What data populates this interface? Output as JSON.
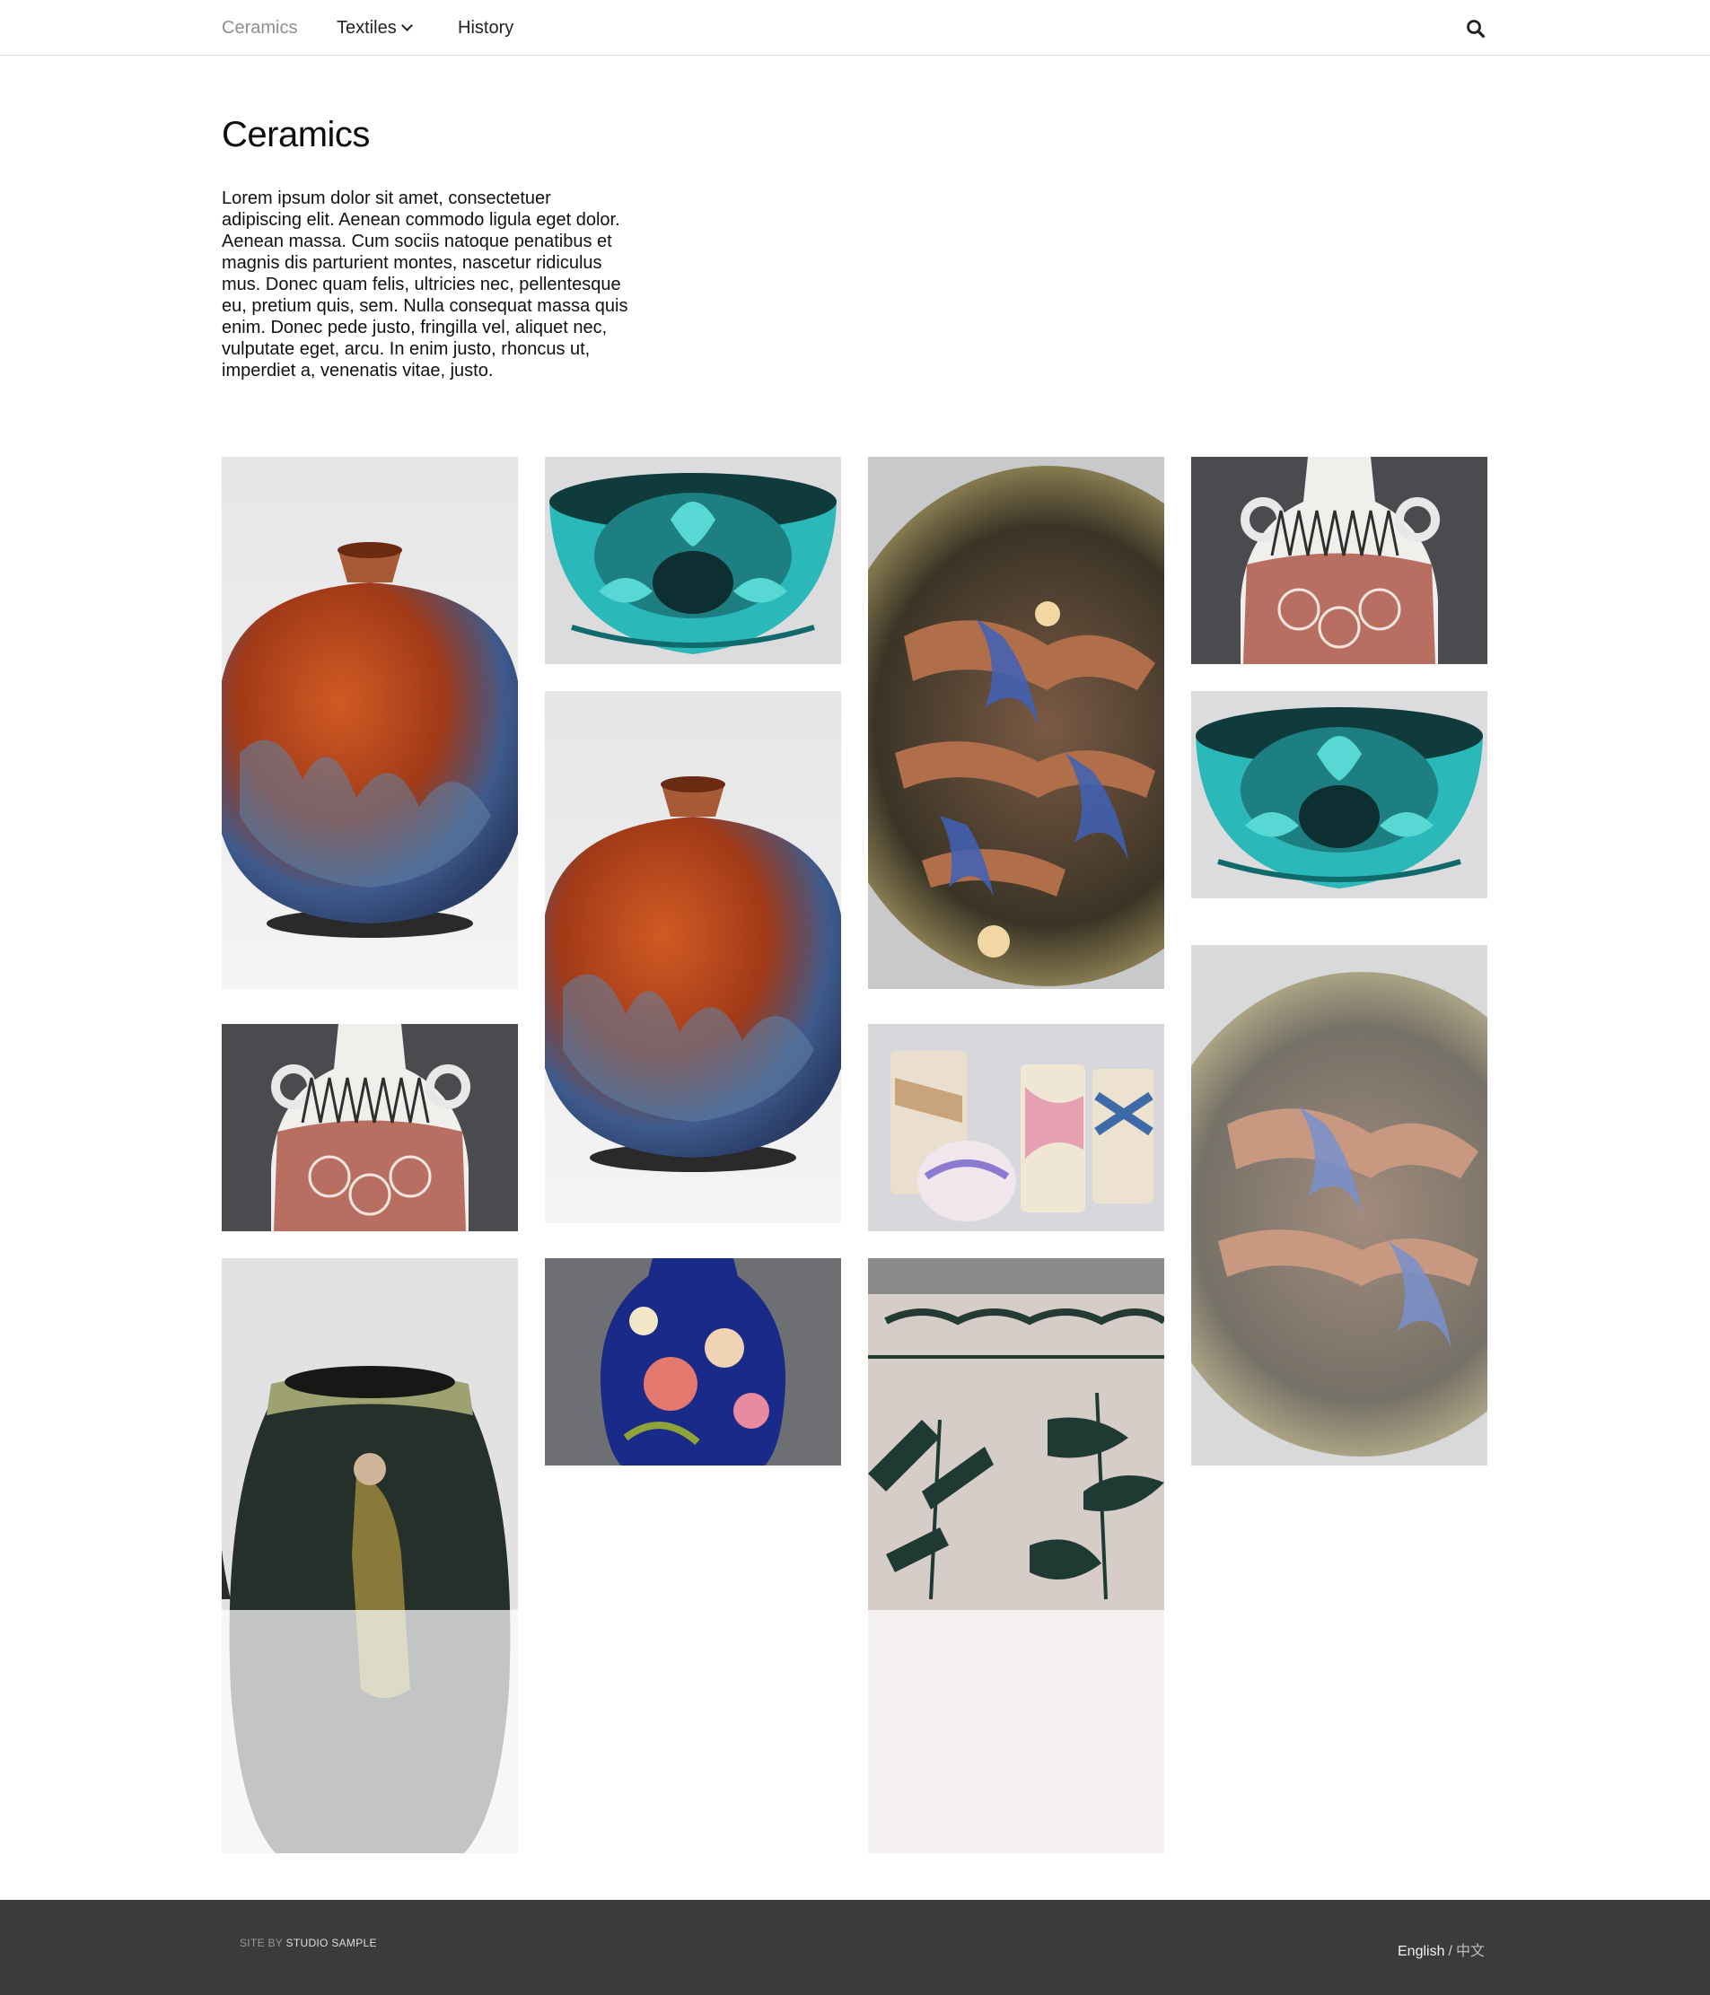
{
  "nav": {
    "items": [
      {
        "label": "Ceramics",
        "active": true
      },
      {
        "label": "Textiles",
        "has_dropdown": true
      },
      {
        "label": "History"
      }
    ],
    "search_icon": "search-icon"
  },
  "page": {
    "title": "Ceramics",
    "intro": "Lorem ipsum dolor sit amet, consectetuer adipiscing elit. Aenean commodo ligula eget dolor. Aenean massa. Cum sociis natoque penatibus et magnis dis parturient montes, nascetur ridiculus mus. Donec quam felis, ultricies nec, pellentesque eu, pretium quis, sem. Nulla consequat massa quis enim. Donec pede justo, fringilla vel, aliquet nec, vulputate eget, arcu. In enim justo, rhoncus ut, imperdiet a, venenatis vitae, justo."
  },
  "gallery": {
    "images": [
      {
        "subject": "raku-glazed lidded vase"
      },
      {
        "subject": "turquoise glazed bowl"
      },
      {
        "subject": "painted stoneware charger"
      },
      {
        "subject": "two-handled patterned bottle"
      },
      {
        "subject": "turquoise glazed bowl"
      },
      {
        "subject": "raku-glazed lidded vase"
      },
      {
        "subject": "two-handled patterned bottle"
      },
      {
        "subject": "group of painted cylinder vases"
      },
      {
        "subject": "painted stoneware charger"
      },
      {
        "subject": "dark glazed figure vase"
      },
      {
        "subject": "blue floral porcelain vase"
      },
      {
        "subject": "geometric painted pottery jar"
      }
    ]
  },
  "footer": {
    "credit_prefix": "SITE BY",
    "credit_name": "STUDIO SAMPLE",
    "lang_english": "English",
    "lang_sep": "/",
    "lang_chinese": "中文"
  },
  "colors": {
    "nav_active": "#8f8f8f",
    "footer_bg": "#3b3b3b",
    "turquoise": "#2ab8b8",
    "rust": "#b5451b"
  }
}
